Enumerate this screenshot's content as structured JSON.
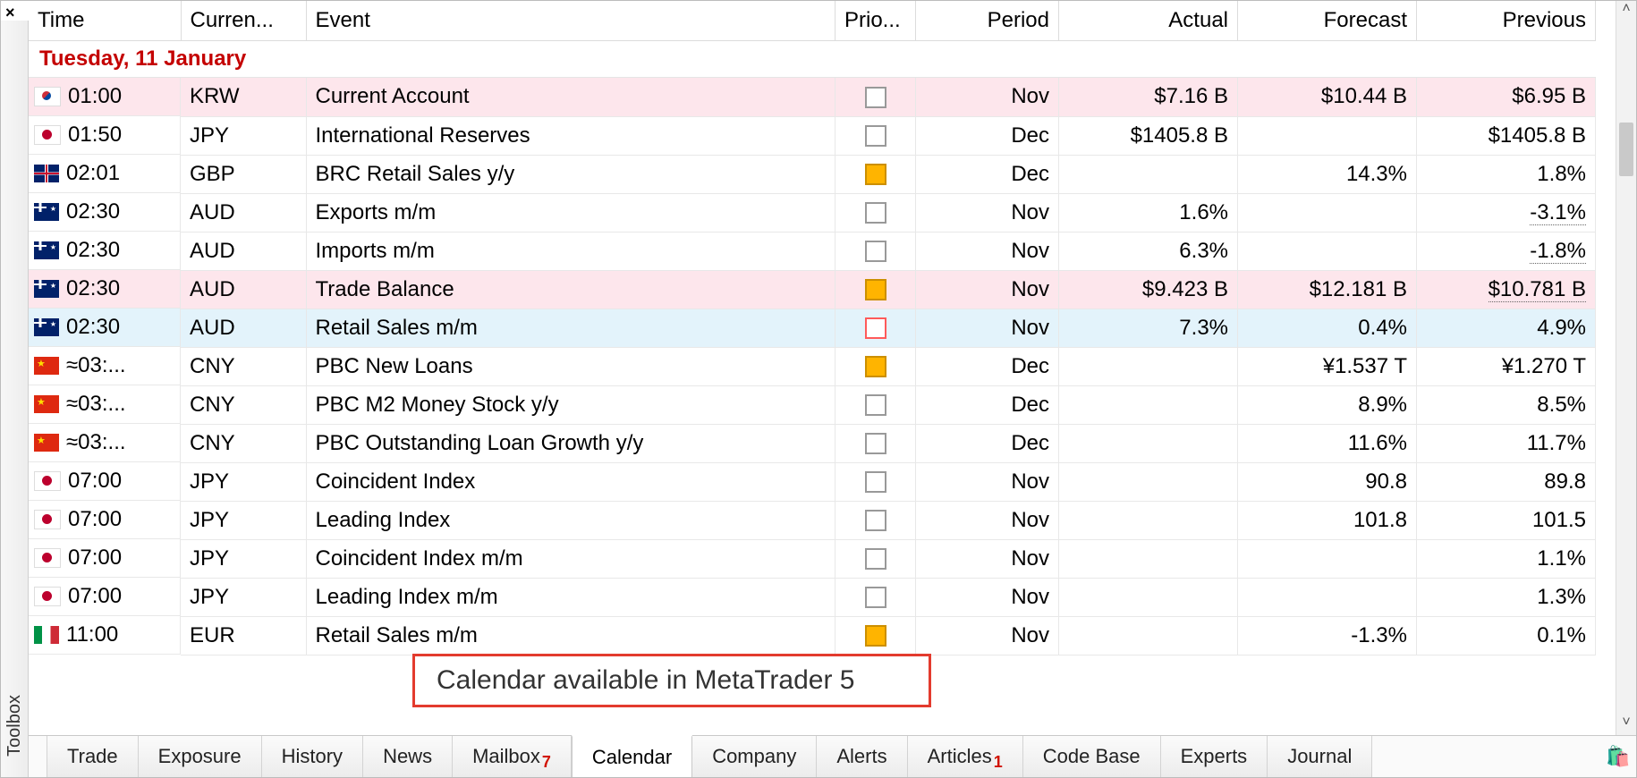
{
  "panel": {
    "title": "Toolbox",
    "close_glyph": "×"
  },
  "columns": {
    "time": "Time",
    "currency": "Curren...",
    "event": "Event",
    "priority": "Prio...",
    "period": "Period",
    "actual": "Actual",
    "forecast": "Forecast",
    "previous": "Previous"
  },
  "date_header": "Tuesday, 11 January",
  "events": [
    {
      "flag": "krw",
      "time": "01:00",
      "currency": "KRW",
      "event": "Current Account",
      "prio": "low",
      "period": "Nov",
      "actual": "$7.16 B",
      "forecast": "$10.44 B",
      "previous": "$6.95 B",
      "row_style": "hl-pink"
    },
    {
      "flag": "jpy",
      "time": "01:50",
      "currency": "JPY",
      "event": "International Reserves",
      "prio": "low",
      "period": "Dec",
      "actual": "$1405.8 B",
      "forecast": "",
      "previous": "$1405.8 B",
      "row_style": ""
    },
    {
      "flag": "gbp",
      "time": "02:01",
      "currency": "GBP",
      "event": "BRC Retail Sales y/y",
      "prio": "medium",
      "period": "Dec",
      "actual": "",
      "forecast": "14.3%",
      "previous": "1.8%",
      "row_style": ""
    },
    {
      "flag": "aud",
      "time": "02:30",
      "currency": "AUD",
      "event": "Exports m/m",
      "prio": "low",
      "period": "Nov",
      "actual": "1.6%",
      "forecast": "",
      "previous": "-3.1%",
      "row_style": "",
      "prev_dotted": true
    },
    {
      "flag": "aud",
      "time": "02:30",
      "currency": "AUD",
      "event": "Imports m/m",
      "prio": "low",
      "period": "Nov",
      "actual": "6.3%",
      "forecast": "",
      "previous": "-1.8%",
      "row_style": "",
      "prev_dotted": true
    },
    {
      "flag": "aud",
      "time": "02:30",
      "currency": "AUD",
      "event": "Trade Balance",
      "prio": "medium",
      "period": "Nov",
      "actual": "$9.423 B",
      "forecast": "$12.181 B",
      "previous": "$10.781 B",
      "row_style": "hl-pink",
      "prev_dotted": true
    },
    {
      "flag": "aud",
      "time": "02:30",
      "currency": "AUD",
      "event": "Retail Sales m/m",
      "prio": "high",
      "period": "Nov",
      "actual": "7.3%",
      "forecast": "0.4%",
      "previous": "4.9%",
      "row_style": "hl-blue"
    },
    {
      "flag": "cny",
      "time": "≈03:...",
      "currency": "CNY",
      "event": "PBC New Loans",
      "prio": "medium",
      "period": "Dec",
      "actual": "",
      "forecast": "¥1.537 T",
      "previous": "¥1.270 T",
      "row_style": ""
    },
    {
      "flag": "cny",
      "time": "≈03:...",
      "currency": "CNY",
      "event": "PBC M2 Money Stock y/y",
      "prio": "low",
      "period": "Dec",
      "actual": "",
      "forecast": "8.9%",
      "previous": "8.5%",
      "row_style": ""
    },
    {
      "flag": "cny",
      "time": "≈03:...",
      "currency": "CNY",
      "event": "PBC Outstanding Loan Growth y/y",
      "prio": "low",
      "period": "Dec",
      "actual": "",
      "forecast": "11.6%",
      "previous": "11.7%",
      "row_style": ""
    },
    {
      "flag": "jpy",
      "time": "07:00",
      "currency": "JPY",
      "event": "Coincident Index",
      "prio": "low",
      "period": "Nov",
      "actual": "",
      "forecast": "90.8",
      "previous": "89.8",
      "row_style": ""
    },
    {
      "flag": "jpy",
      "time": "07:00",
      "currency": "JPY",
      "event": "Leading Index",
      "prio": "low",
      "period": "Nov",
      "actual": "",
      "forecast": "101.8",
      "previous": "101.5",
      "row_style": ""
    },
    {
      "flag": "jpy",
      "time": "07:00",
      "currency": "JPY",
      "event": "Coincident Index m/m",
      "prio": "low",
      "period": "Nov",
      "actual": "",
      "forecast": "",
      "previous": "1.1%",
      "row_style": ""
    },
    {
      "flag": "jpy",
      "time": "07:00",
      "currency": "JPY",
      "event": "Leading Index m/m",
      "prio": "low",
      "period": "Nov",
      "actual": "",
      "forecast": "",
      "previous": "1.3%",
      "row_style": ""
    },
    {
      "flag": "eur",
      "time": "11:00",
      "currency": "EUR",
      "event": "Retail Sales m/m",
      "prio": "medium",
      "period": "Nov",
      "actual": "",
      "forecast": "-1.3%",
      "previous": "0.1%",
      "row_style": ""
    }
  ],
  "tabs": [
    {
      "label": "Trade",
      "active": false,
      "badge": ""
    },
    {
      "label": "Exposure",
      "active": false,
      "badge": ""
    },
    {
      "label": "History",
      "active": false,
      "badge": ""
    },
    {
      "label": "News",
      "active": false,
      "badge": ""
    },
    {
      "label": "Mailbox",
      "active": false,
      "badge": "7"
    },
    {
      "label": "Calendar",
      "active": true,
      "badge": ""
    },
    {
      "label": "Company",
      "active": false,
      "badge": ""
    },
    {
      "label": "Alerts",
      "active": false,
      "badge": ""
    },
    {
      "label": "Articles",
      "active": false,
      "badge": "1"
    },
    {
      "label": "Code Base",
      "active": false,
      "badge": ""
    },
    {
      "label": "Experts",
      "active": false,
      "badge": ""
    },
    {
      "label": "Journal",
      "active": false,
      "badge": ""
    }
  ],
  "market_icon_glyph": "🛍️",
  "annotation": {
    "text": "Calendar available in MetaTrader 5"
  },
  "scroll": {
    "up": "˄",
    "down": "˅"
  }
}
